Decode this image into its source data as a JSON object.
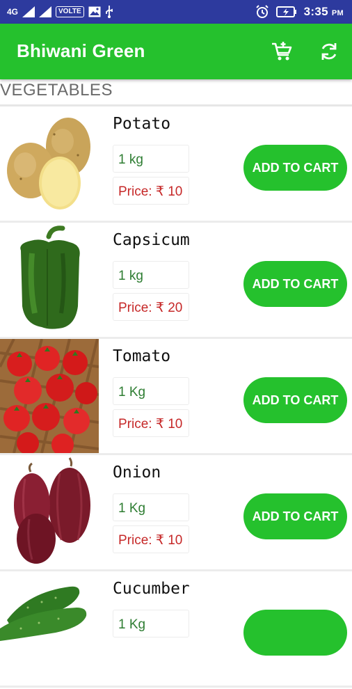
{
  "status_bar": {
    "network": "4G",
    "volte": "VOLTE",
    "time": "3:35",
    "ampm": "PM"
  },
  "toolbar": {
    "title": "Bhiwani Green",
    "cart_icon": "add-cart-icon",
    "refresh_icon": "refresh-icon"
  },
  "section": {
    "title": "VEGETABLES"
  },
  "items": [
    {
      "name": "Potato",
      "quantity": "1 kg",
      "price": "Price: ₹ 10",
      "button": "ADD TO CART"
    },
    {
      "name": "Capsicum",
      "quantity": "1 kg",
      "price": "Price: ₹ 20",
      "button": "ADD TO CART"
    },
    {
      "name": "Tomato",
      "quantity": "1 Kg",
      "price": "Price: ₹ 10",
      "button": "ADD TO CART"
    },
    {
      "name": "Onion",
      "quantity": "1 Kg",
      "price": "Price: ₹ 10",
      "button": "ADD TO CART"
    },
    {
      "name": "Cucumber",
      "quantity": "1 Kg",
      "price": "",
      "button": ""
    }
  ],
  "colors": {
    "status_bar": "#2d3a9e",
    "primary": "#25c12d",
    "quantity_text": "#2e7d32",
    "price_text": "#c62828"
  }
}
